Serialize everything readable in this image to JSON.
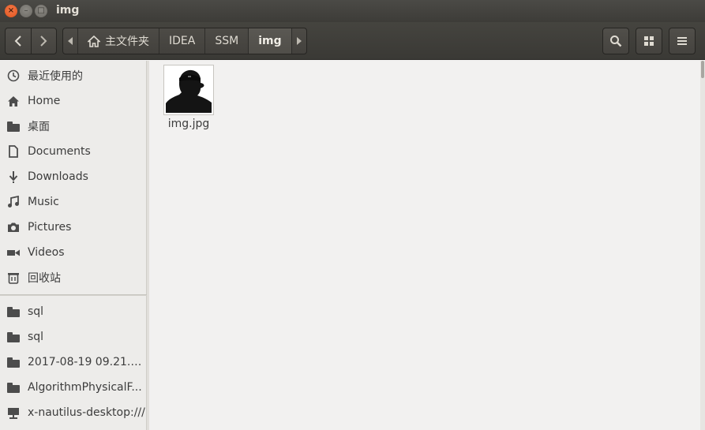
{
  "window": {
    "title": "img",
    "controls": {
      "close": "×",
      "minimize": "–",
      "maximize": "□"
    }
  },
  "toolbar": {
    "back_icon": "chevron-left-icon",
    "forward_icon": "chevron-right-icon",
    "path": [
      "主文件夹",
      "IDEA",
      "SSM",
      "img"
    ],
    "active_crumb": "img",
    "search_icon": "search-icon",
    "view_icon": "grid-icon",
    "menu_icon": "hamburger-menu-icon"
  },
  "sidebar": {
    "places": [
      {
        "label": "最近使用的",
        "icon": "clock-icon"
      },
      {
        "label": "Home",
        "icon": "home-icon"
      },
      {
        "label": "桌面",
        "icon": "folder-icon"
      },
      {
        "label": "Documents",
        "icon": "document-icon"
      },
      {
        "label": "Downloads",
        "icon": "download-icon"
      },
      {
        "label": "Music",
        "icon": "music-icon"
      },
      {
        "label": "Pictures",
        "icon": "camera-icon"
      },
      {
        "label": "Videos",
        "icon": "video-icon"
      },
      {
        "label": "回收站",
        "icon": "trash-icon"
      }
    ],
    "bookmarks": [
      {
        "label": "sql",
        "icon": "folder-icon"
      },
      {
        "label": "sql",
        "icon": "folder-icon"
      },
      {
        "label": "2017-08-19 09.21.42 ...",
        "icon": "folder-icon"
      },
      {
        "label": "AlgorithmPhysicalF...",
        "icon": "folder-icon"
      },
      {
        "label": "x-nautilus-desktop:///",
        "icon": "network-icon"
      }
    ]
  },
  "files": [
    {
      "name": "img.jpg",
      "type": "image"
    }
  ],
  "colors": {
    "titlebar": "#3d3c38",
    "accent_close": "#e0531c",
    "sidebar_bg": "#edecea",
    "main_bg": "#f2f1f0"
  }
}
